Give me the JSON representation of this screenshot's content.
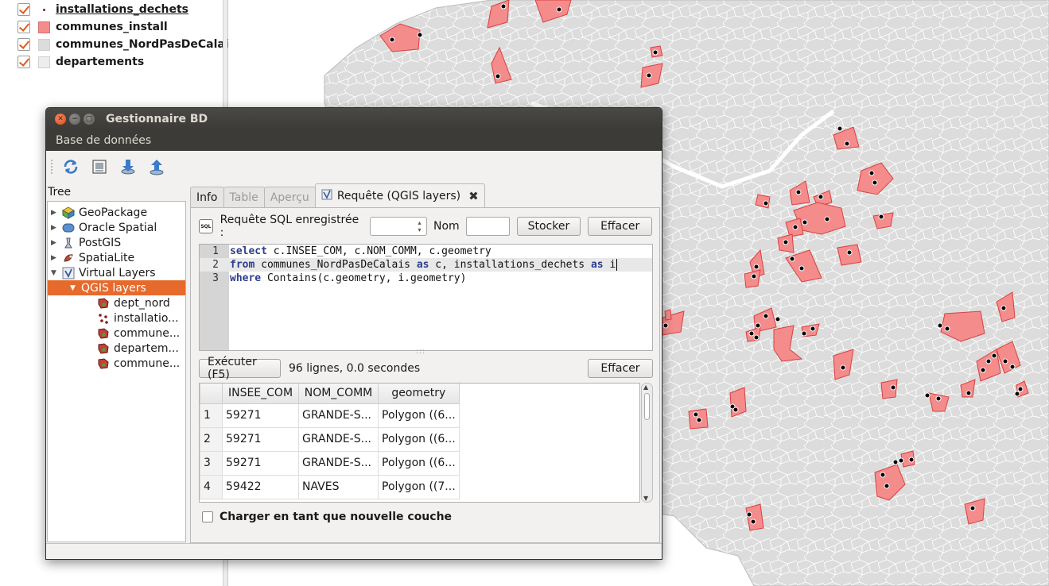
{
  "layers_panel": {
    "layers": [
      {
        "name": "installations_dechets",
        "checked": true,
        "symbol": "point-icon",
        "selected": true
      },
      {
        "name": "communes_install",
        "checked": true,
        "symbol": "pink-fill",
        "color": "#f48c8c"
      },
      {
        "name": "communes_NordPasDeCalais",
        "checked": true,
        "symbol": "grey-fill",
        "color": "#dcdcdc"
      },
      {
        "name": "departements",
        "checked": true,
        "symbol": "light-grey-fill",
        "color": "#ededed"
      }
    ]
  },
  "map": {
    "highlight_color": "#f48c8c",
    "commune_color": "#dcdcdc",
    "point_color": "#000000"
  },
  "dialog": {
    "title": "Gestionnaire BD",
    "menu": [
      "Base de données"
    ],
    "toolbar": [
      "refresh-icon",
      "sql-window-icon",
      "import-icon",
      "export-icon"
    ],
    "tree_label": "Tree",
    "tree": [
      {
        "label": "GeoPackage",
        "icon": "geopackage-icon",
        "depth": 0,
        "arrow": "▶"
      },
      {
        "label": "Oracle Spatial",
        "icon": "oracle-icon",
        "depth": 0,
        "arrow": "▶"
      },
      {
        "label": "PostGIS",
        "icon": "postgis-icon",
        "depth": 0,
        "arrow": "▶"
      },
      {
        "label": "SpatiaLite",
        "icon": "spatialite-icon",
        "depth": 0,
        "arrow": "▶"
      },
      {
        "label": "Virtual Layers",
        "icon": "virtual-layers-icon",
        "depth": 0,
        "arrow": "▼"
      },
      {
        "label": "QGIS layers",
        "icon": "",
        "depth": 1,
        "arrow": "▼",
        "active": true
      },
      {
        "label": "dept_nord",
        "icon": "polygon-layer-icon",
        "depth": 2,
        "arrow": ""
      },
      {
        "label": "installatio...",
        "icon": "point-layer-icon",
        "depth": 2,
        "arrow": ""
      },
      {
        "label": "commune...",
        "icon": "polygon-layer-icon",
        "depth": 2,
        "arrow": ""
      },
      {
        "label": "departem...",
        "icon": "polygon-layer-icon",
        "depth": 2,
        "arrow": ""
      },
      {
        "label": "commune...",
        "icon": "polygon-layer-icon",
        "depth": 2,
        "arrow": ""
      }
    ],
    "tabs": [
      {
        "label": "Info",
        "state": "normal"
      },
      {
        "label": "Table",
        "state": "disabled"
      },
      {
        "label": "Aperçu",
        "state": "disabled"
      },
      {
        "label": "Requête (QGIS layers)",
        "state": "current",
        "closable": "✖"
      }
    ],
    "query": {
      "saved_label": "Requête SQL enregistrée :",
      "saved_value": "",
      "name_label": "Nom",
      "name_value": "",
      "store_button": "Stocker",
      "clear_button": "Effacer",
      "sql_icon_text": "SQL",
      "lines": [
        {
          "n": "1",
          "parts": [
            {
              "t": "select",
              "kw": true
            },
            {
              "t": " c.INSEE_COM, c.NOM_COMM, c.geometry",
              "kw": false
            }
          ]
        },
        {
          "n": "2",
          "parts": [
            {
              "t": "from",
              "kw": true
            },
            {
              "t": " communes_NordPasDeCalais ",
              "kw": false
            },
            {
              "t": "as",
              "kw": true
            },
            {
              "t": " c, installations_dechets ",
              "kw": false
            },
            {
              "t": "as",
              "kw": true
            },
            {
              "t": " i",
              "kw": false
            }
          ]
        },
        {
          "n": "3",
          "parts": [
            {
              "t": "where",
              "kw": true
            },
            {
              "t": " Contains(c.geometry, i.geometry)",
              "kw": false
            }
          ]
        }
      ],
      "execute_button": "Exécuter (F5)",
      "result_status": "96 lignes, 0.0 secondes",
      "clear_result_button": "Effacer"
    },
    "results": {
      "columns": [
        "INSEE_COM",
        "NOM_COMM",
        "geometry"
      ],
      "rows": [
        {
          "n": "1",
          "cells": [
            "59271",
            "GRANDE-S...",
            "Polygon ((6..."
          ]
        },
        {
          "n": "2",
          "cells": [
            "59271",
            "GRANDE-S...",
            "Polygon ((6..."
          ]
        },
        {
          "n": "3",
          "cells": [
            "59271",
            "GRANDE-S...",
            "Polygon ((6..."
          ]
        },
        {
          "n": "4",
          "cells": [
            "59422",
            "NAVES",
            "Polygon ((7..."
          ]
        }
      ]
    },
    "load_as_layer": "Charger en tant que nouvelle couche"
  }
}
